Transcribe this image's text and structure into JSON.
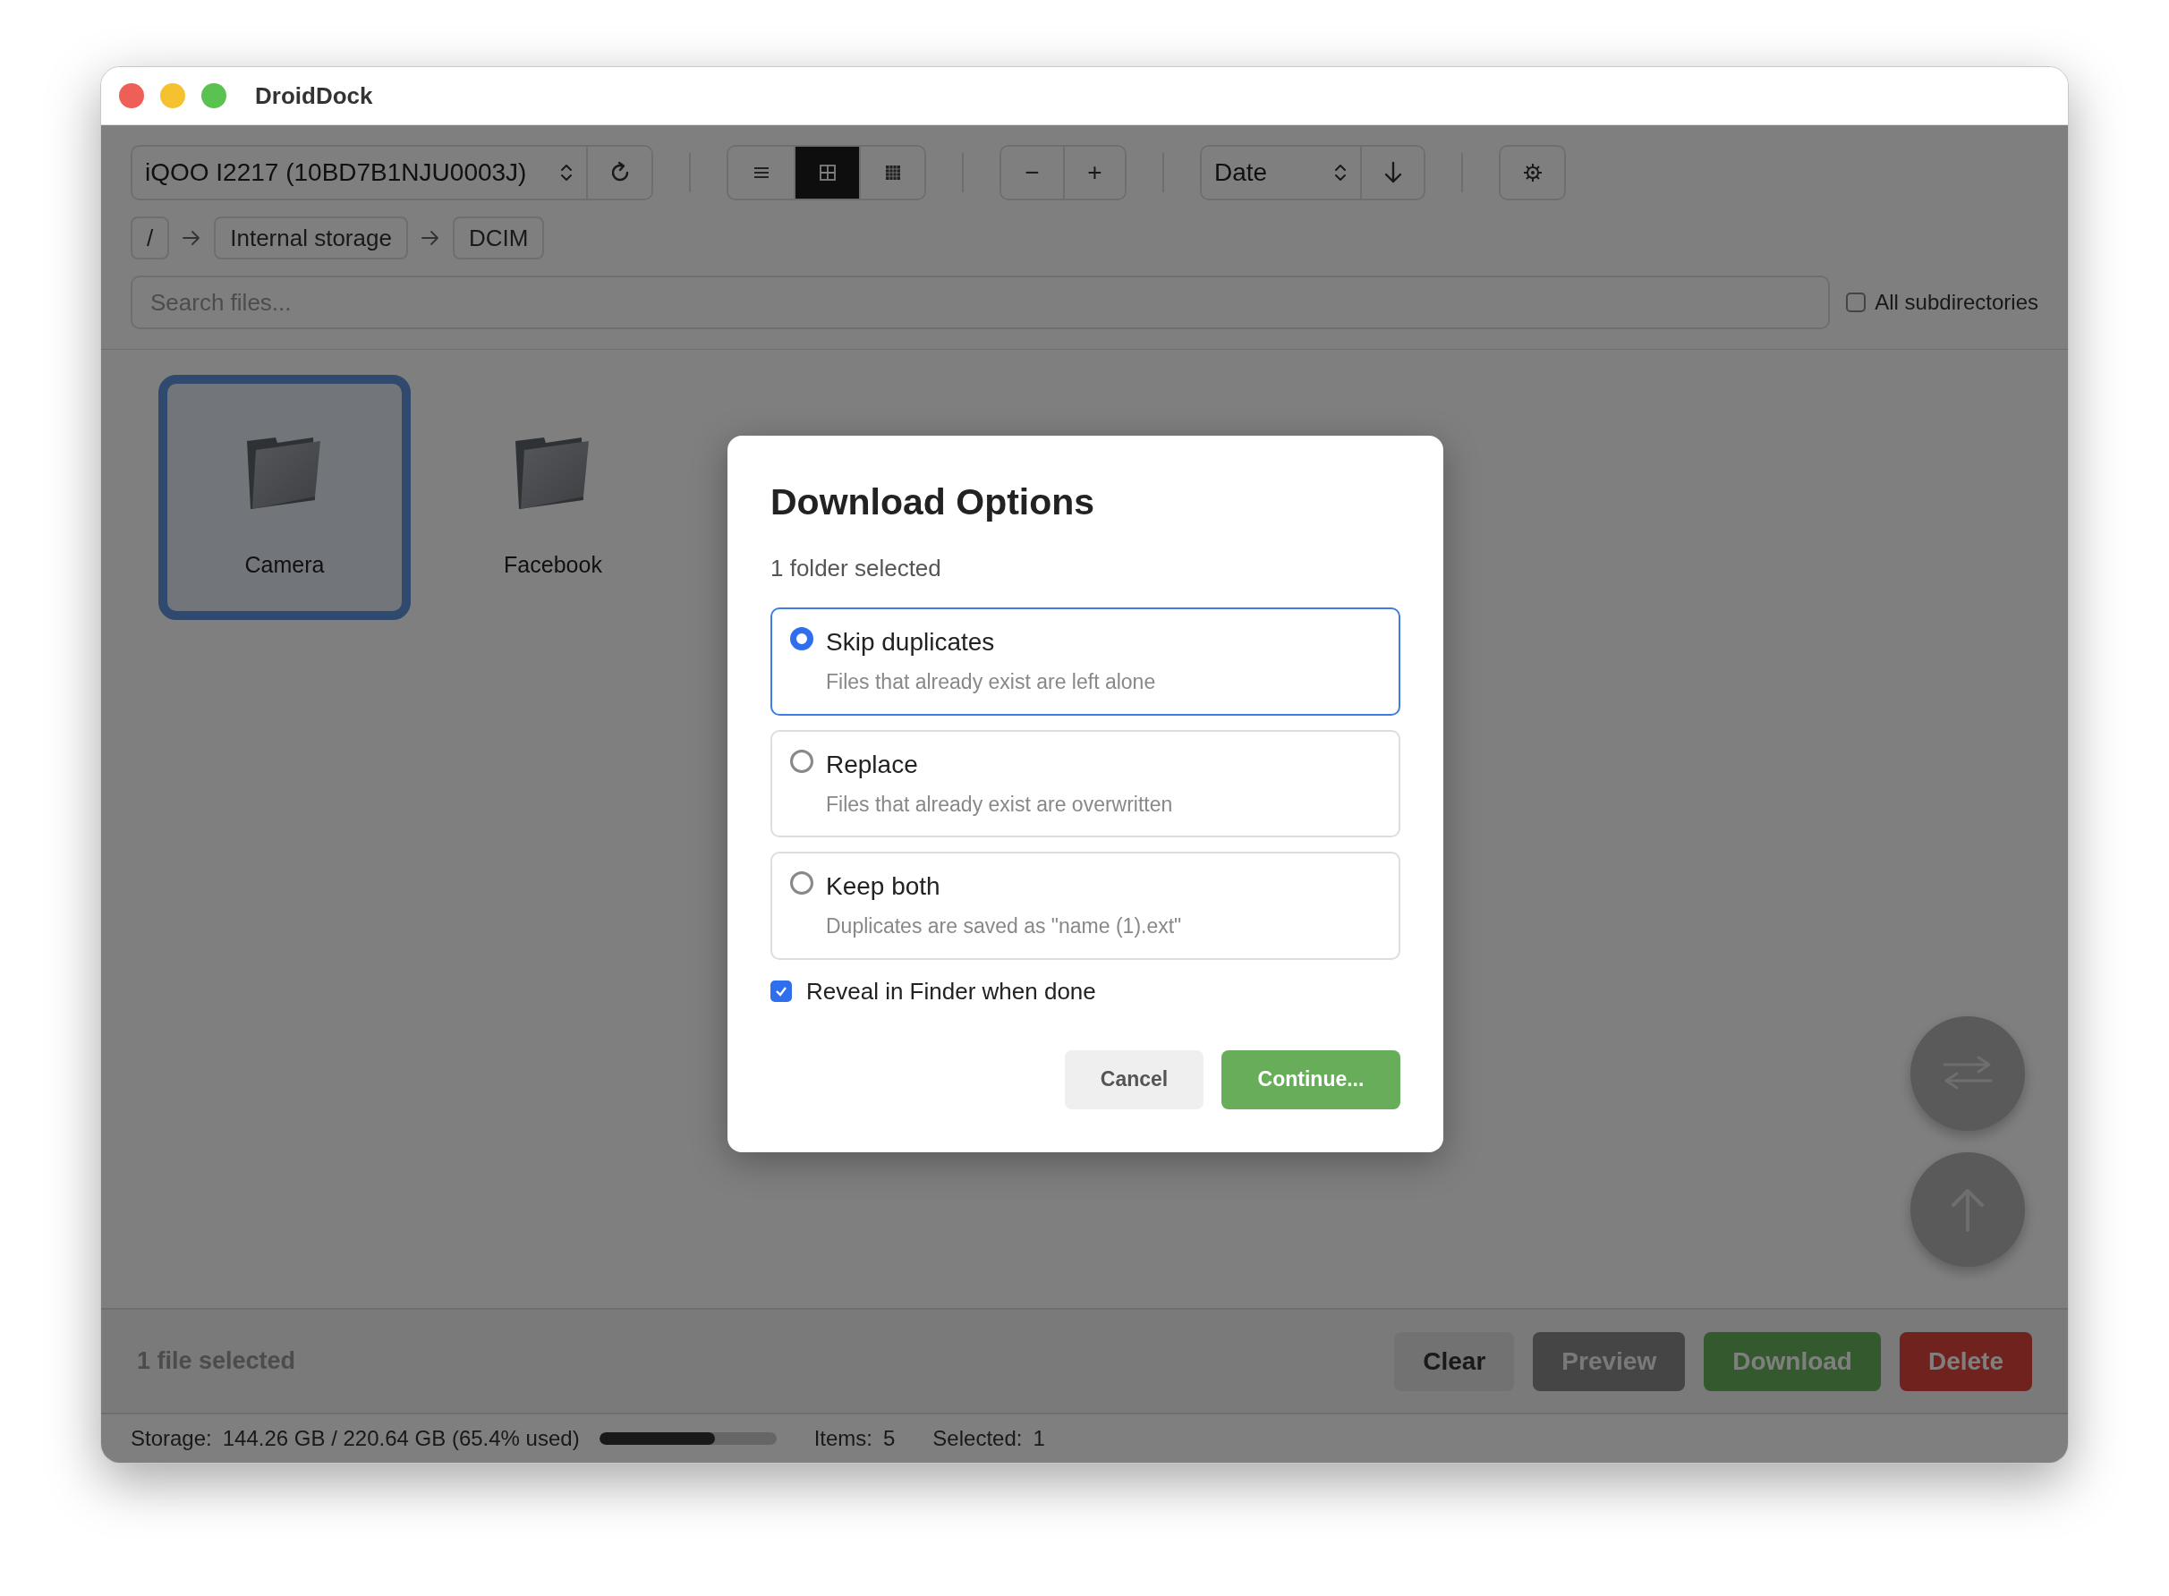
{
  "window": {
    "title": "DroidDock"
  },
  "toolbar": {
    "device": "iQOO I2217 (10BD7B1NJU0003J)",
    "view_modes": [
      {
        "kind": "list",
        "selected": false
      },
      {
        "kind": "grid",
        "selected": true
      },
      {
        "kind": "large",
        "selected": false
      }
    ],
    "zoom_out": "−",
    "zoom_in": "+",
    "sort": "Date"
  },
  "breadcrumb": [
    "/",
    "Internal storage",
    "DCIM"
  ],
  "search": {
    "placeholder": "Search files..."
  },
  "all_subdirectories": {
    "label": "All subdirectories",
    "checked": false
  },
  "files": [
    {
      "name": "Camera",
      "selected": true
    },
    {
      "name": "Facebook",
      "selected": false
    }
  ],
  "action_bar": {
    "selection": "1 file selected",
    "buttons": [
      {
        "label": "Clear",
        "kind": "clear"
      },
      {
        "label": "Preview",
        "kind": "preview"
      },
      {
        "label": "Download",
        "kind": "download"
      },
      {
        "label": "Delete",
        "kind": "delete"
      }
    ]
  },
  "status_bar": {
    "storage_label": "Storage:",
    "storage": "144.26 GB / 220.64 GB (65.4% used)",
    "level": 0.654,
    "items_label": "Items:",
    "items": "5",
    "selected_label": "Selected:",
    "selected_count": "1"
  },
  "dialog": {
    "title": "Download Options",
    "subtitle": "1 folder selected",
    "options": [
      {
        "label": "Skip duplicates",
        "description": "Files that already exist are left alone",
        "selected": true
      },
      {
        "label": "Replace",
        "description": "Files that already exist are overwritten",
        "selected": false
      },
      {
        "label": "Keep both",
        "description": "Duplicates are saved as \"name (1).ext\"",
        "selected": false
      }
    ],
    "reveal": {
      "label": "Reveal in Finder when done",
      "checked": true
    },
    "buttons": [
      {
        "label": "Cancel",
        "kind": "secondary"
      },
      {
        "label": "Continue...",
        "kind": "primary"
      }
    ]
  }
}
